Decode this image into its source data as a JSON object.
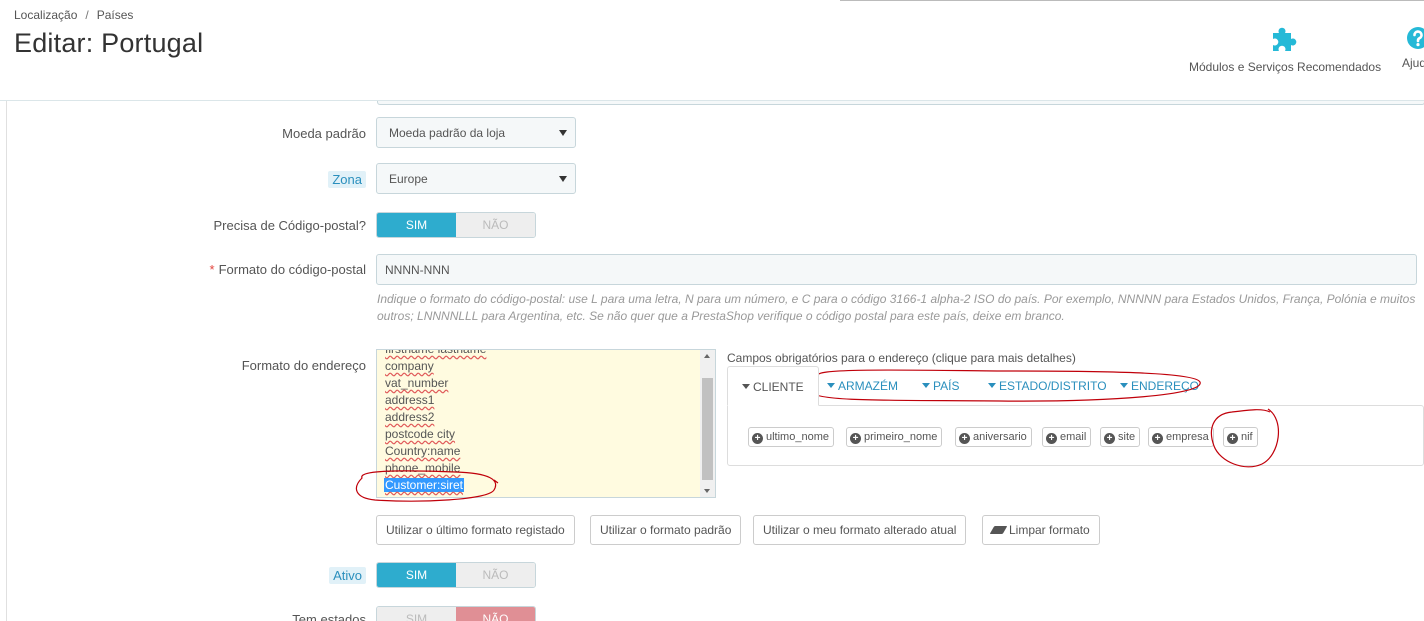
{
  "header": {
    "breadcrumb": [
      "Localização",
      "Países"
    ],
    "breadcrumb_sep": "/",
    "title": "Editar: Portugal",
    "toolbar": {
      "modules_label": "Módulos e Serviços Recomendados",
      "help_label": "Ajuda",
      "modules_icon": "puzzle-icon",
      "help_icon": "help-icon"
    },
    "accent": "#25b9d7"
  },
  "form": {
    "currency": {
      "label": "Moeda padrão",
      "value": "Moeda padrão da loja"
    },
    "zone": {
      "label": "Zona",
      "value": "Europe"
    },
    "needs_zip": {
      "label": "Precisa de Código-postal?",
      "yes": "SIM",
      "no": "NÃO",
      "selected": "yes"
    },
    "zip_format": {
      "required_mark": "*",
      "label": "Formato do código-postal",
      "value": "NNNN-NNN",
      "help": "Indique o formato do código-postal: use L para uma letra, N para um número, e C para o código 3166-1 alpha-2 ISO do país. Por exemplo, NNNNN para Estados Unidos, França, Polónia e muitos outros; LNNNNLLL para Argentina, etc. Se não quer que a PrestaShop verifique o código postal para este país, deixe em branco."
    },
    "address_format": {
      "label": "Formato do endereço",
      "lines": [
        "firstname lastname",
        "company",
        "vat_number",
        "address1",
        "address2",
        "postcode city",
        "Country:name",
        "phone_mobile",
        "Customer:siret"
      ],
      "selected_line": "Customer:siret"
    },
    "required_fields": {
      "title": "Campos obrigatórios para o endereço (clique para mais detalhes)",
      "tabs": [
        "CLIENTE",
        "ARMAZÉM",
        "PAÍS",
        "ESTADO/DISTRITO",
        "ENDEREÇO"
      ],
      "active_tab": "CLIENTE",
      "chips": [
        "ultimo_nome",
        "primeiro_nome",
        "aniversario",
        "email",
        "site",
        "empresa",
        "nif"
      ]
    },
    "format_buttons": {
      "last": "Utilizar o último formato registado",
      "default": "Utilizar o formato padrão",
      "current": "Utilizar o meu formato alterado atual",
      "clear": "Limpar formato"
    },
    "active": {
      "label": "Ativo",
      "yes": "SIM",
      "no": "NÃO",
      "selected": "yes"
    },
    "has_states": {
      "label": "Tem estados",
      "yes": "SIM",
      "no": "NÃO",
      "selected": "no"
    }
  },
  "colors": {
    "switch_on": "#2eacce",
    "switch_no_on": "#e08f95",
    "link": "#2a8fbd",
    "annotation": "#c0000a"
  }
}
